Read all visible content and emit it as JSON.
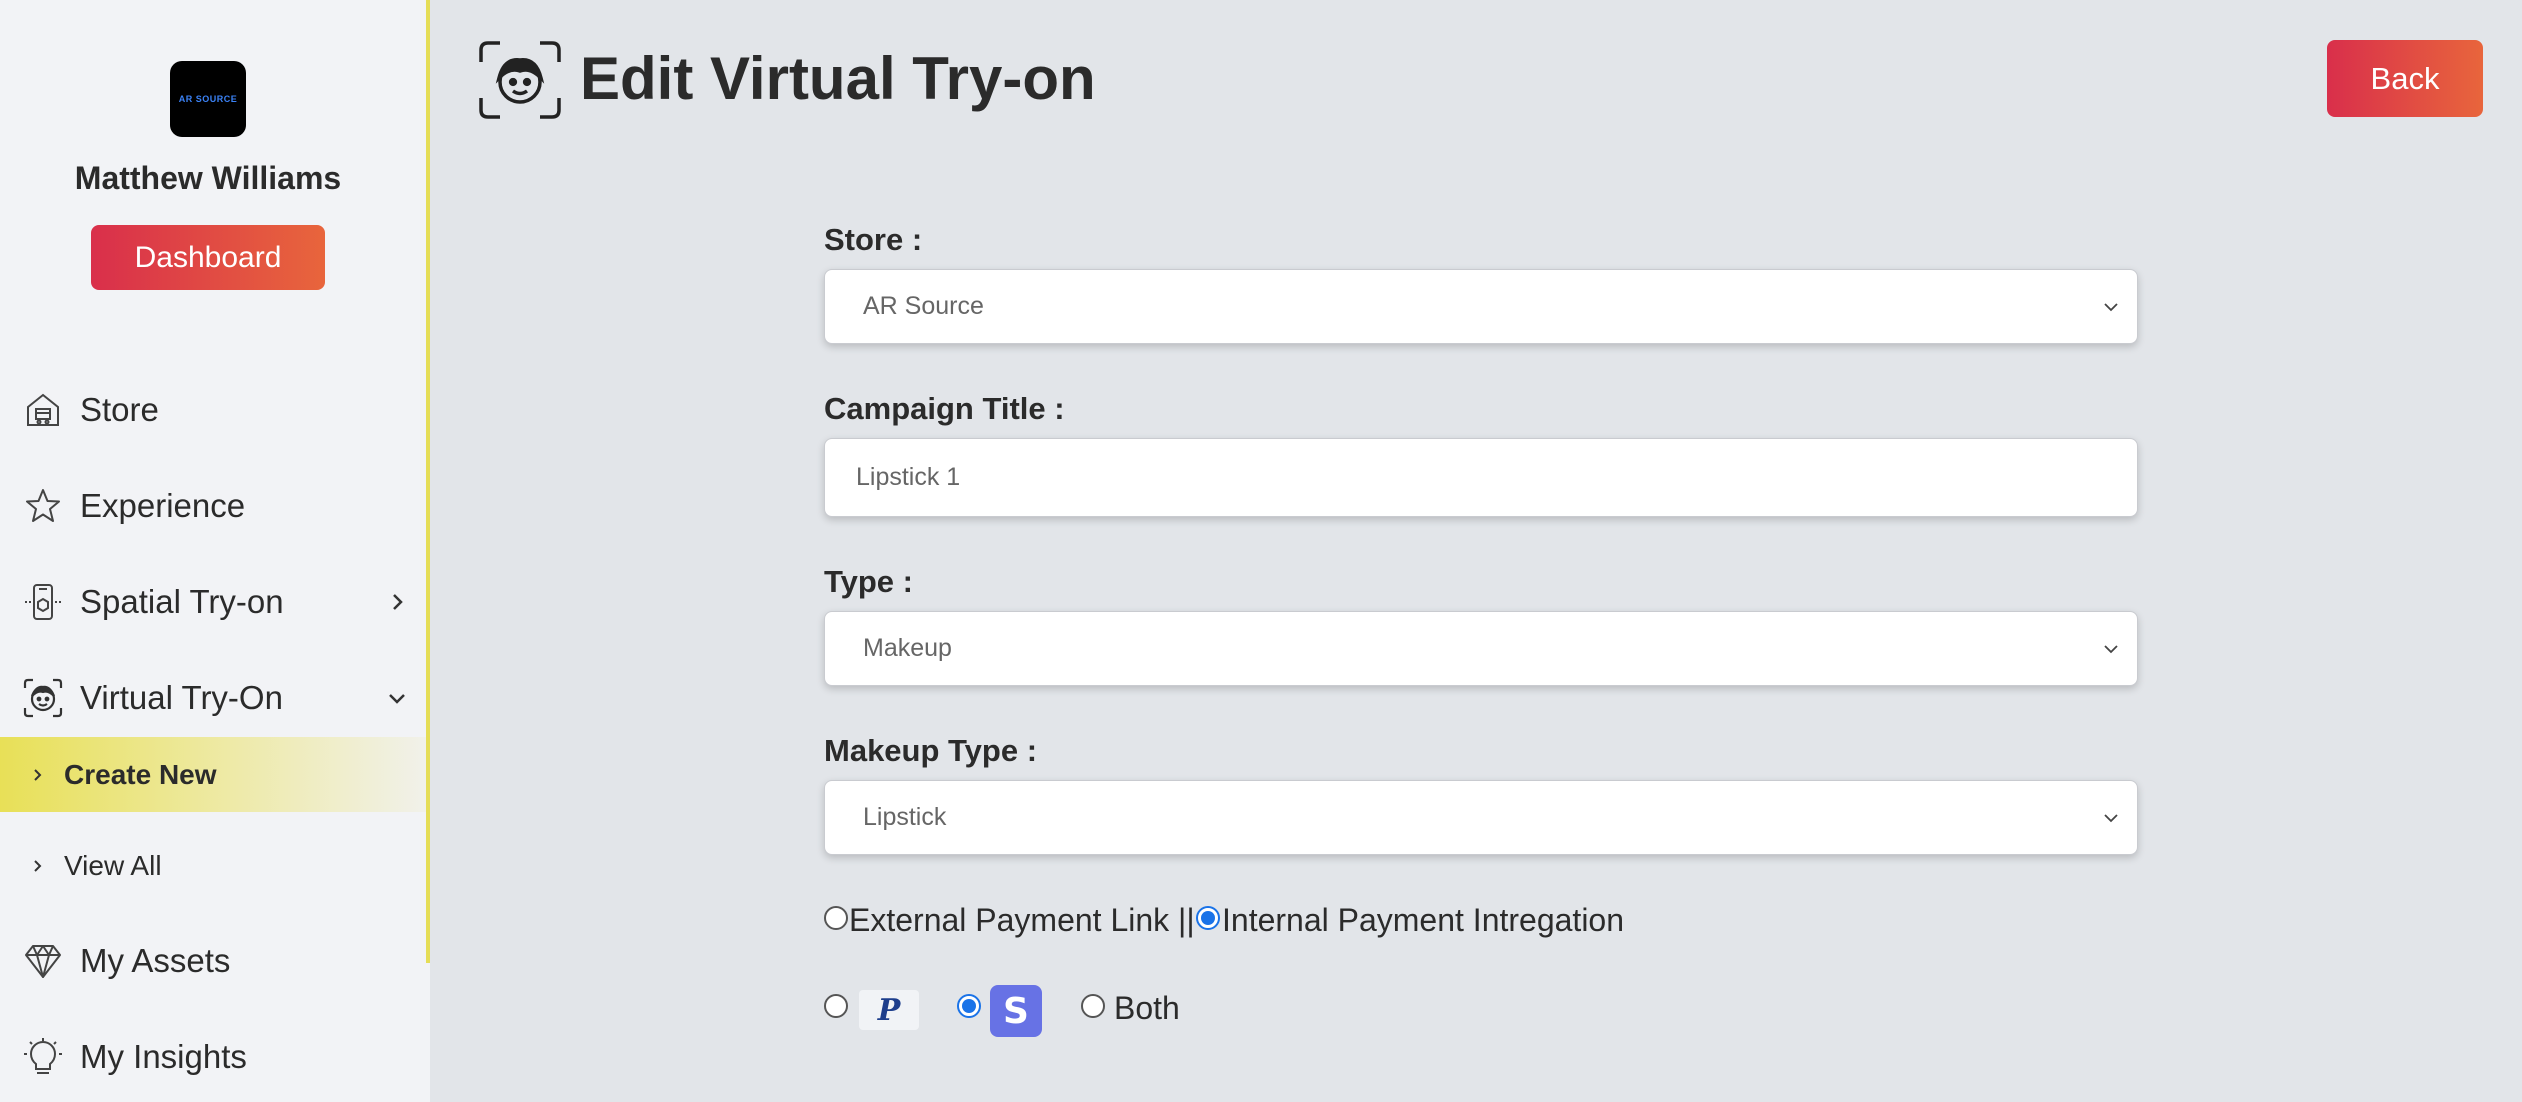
{
  "sidebar": {
    "logo_text": "AR SOURCE",
    "user_name": "Matthew Williams",
    "dashboard_label": "Dashboard",
    "items": [
      {
        "label": "Store",
        "icon": "store-icon"
      },
      {
        "label": "Experience",
        "icon": "star-icon"
      },
      {
        "label": "Spatial Try-on",
        "icon": "phone-ar-icon"
      },
      {
        "label": "Virtual Try-On",
        "icon": "face-scan-icon"
      },
      {
        "label": "My Assets",
        "icon": "diamond-icon"
      },
      {
        "label": "My Insights",
        "icon": "lightbulb-icon"
      }
    ],
    "subitems": [
      {
        "label": "Create New",
        "active": true
      },
      {
        "label": "View All",
        "active": false
      }
    ]
  },
  "header": {
    "title": "Edit Virtual Try-on",
    "back_label": "Back"
  },
  "form": {
    "store": {
      "label": "Store :",
      "value": "AR Source"
    },
    "campaign_title": {
      "label": "Campaign Title :",
      "value": "Lipstick 1"
    },
    "type": {
      "label": "Type :",
      "value": "Makeup"
    },
    "makeup_type": {
      "label": "Makeup Type :",
      "value": "Lipstick"
    },
    "payment_mode": {
      "external_label": "External Payment Link ||",
      "internal_label": "Internal Payment Intregation",
      "selected": "internal"
    },
    "provider": {
      "paypal_letter": "P",
      "stripe_letter": "S",
      "both_label": "Both",
      "selected": "stripe"
    }
  },
  "colors": {
    "accent_gradient_start": "#d92f4b",
    "accent_gradient_end": "#e8653c",
    "active_highlight": "#e8e057",
    "sidebar_border": "#e5dd56",
    "radio_checked": "#1a73e8",
    "stripe": "#6772e5"
  }
}
